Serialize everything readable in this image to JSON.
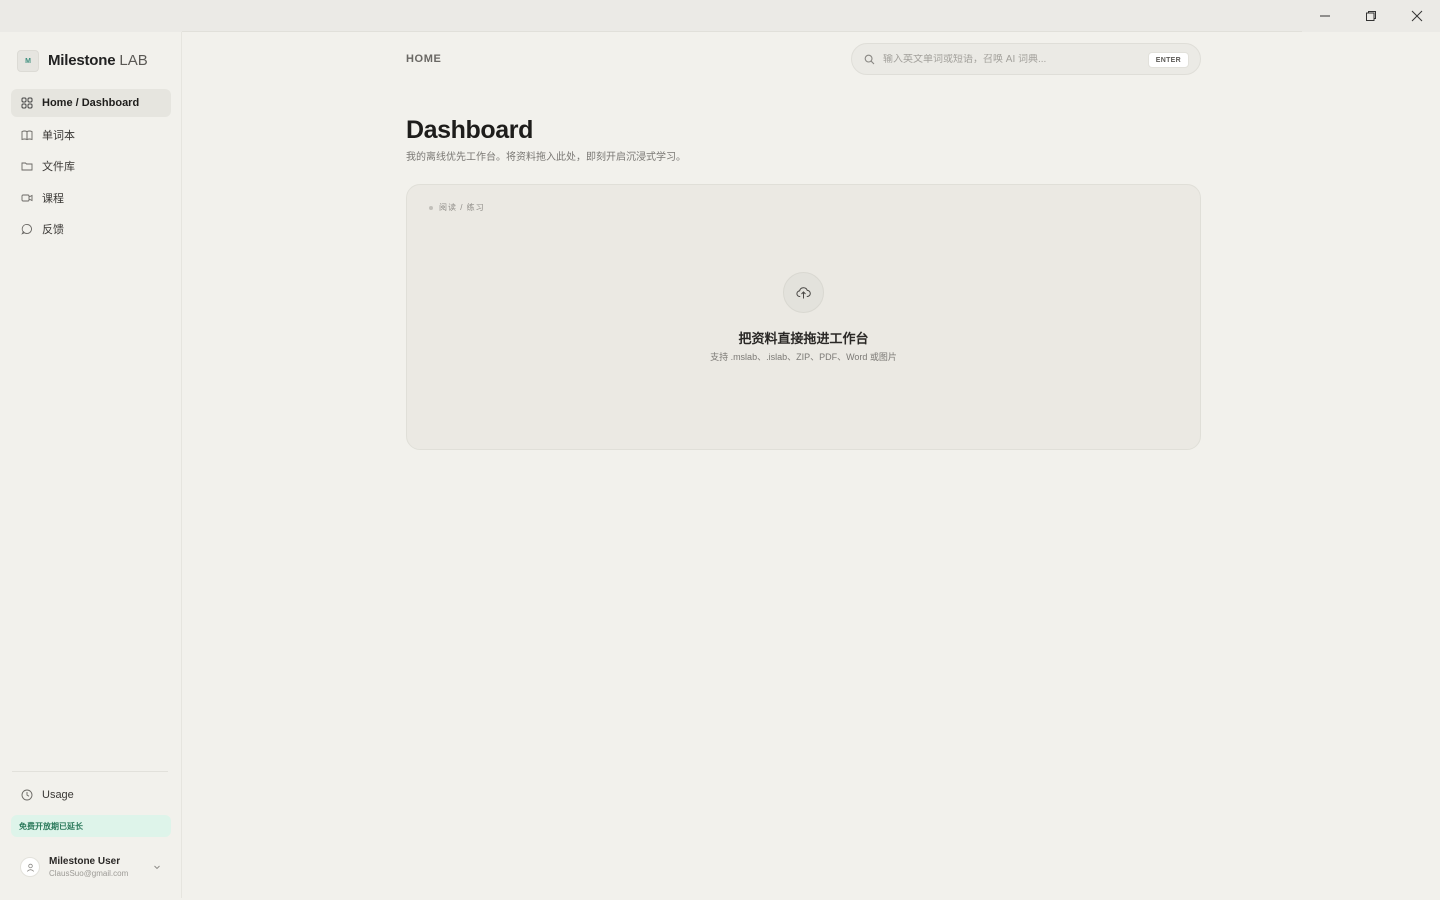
{
  "brand": {
    "logo_text": "M",
    "name": "Milestone",
    "suffix": "LAB"
  },
  "sidebar": {
    "items": [
      {
        "label": "Home / Dashboard",
        "icon": "grid-icon",
        "active": true
      },
      {
        "label": "单词本",
        "icon": "book-icon",
        "active": false
      },
      {
        "label": "文件库",
        "icon": "folder-icon",
        "active": false
      },
      {
        "label": "课程",
        "icon": "video-icon",
        "active": false
      },
      {
        "label": "反馈",
        "icon": "chat-icon",
        "active": false
      }
    ],
    "usage_label": "Usage",
    "promo_text": "免费开放期已延长",
    "user": {
      "name": "Milestone User",
      "email": "ClausSuo@gmail.com"
    }
  },
  "header": {
    "breadcrumb": "HOME",
    "search_placeholder": "输入英文单词或短语，召唤 AI 词典...",
    "search_value": "",
    "enter_label": "ENTER"
  },
  "main": {
    "title": "Dashboard",
    "subtitle": "我的离线优先工作台。将资料拖入此处，即刻开启沉浸式学习。",
    "dropzone": {
      "mode_tag": "阅读 / 练习",
      "title": "把资料直接拖进工作台",
      "subtitle": "支持 .mslab、.islab、ZIP、PDF、Word 或图片"
    }
  },
  "colors": {
    "background": "#f2f1ec",
    "sidebar_active": "#e6e5df",
    "accent_green": "#2c7a5c",
    "promo_bg": "#def4ea"
  }
}
